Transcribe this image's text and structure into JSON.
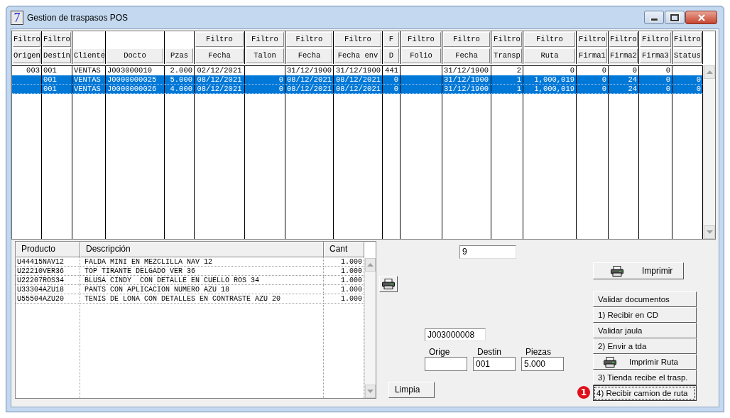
{
  "window": {
    "title": "Gestion de traspasos POS",
    "app_icon": "7"
  },
  "transfers": {
    "columns": [
      {
        "label": "Origen",
        "filter": "Filtro"
      },
      {
        "label": "Destin",
        "filter": "Filtro"
      },
      {
        "label": "Cliente"
      },
      {
        "label": "Docto"
      },
      {
        "label": "Pzas"
      },
      {
        "label": "Fecha",
        "filter": "Filtro"
      },
      {
        "label": "Talon",
        "filter": "Filtro"
      },
      {
        "label": "Fecha",
        "filter": "Filtro"
      },
      {
        "label": "Fecha env",
        "filter": "Filtro"
      },
      {
        "label": "D",
        "filter": "F"
      },
      {
        "label": "Folio",
        "filter": "Filtro"
      },
      {
        "label": "Fecha",
        "filter": "Filtro"
      },
      {
        "label": "Transp",
        "filter": "Filtro"
      },
      {
        "label": "Ruta",
        "filter": "Filtro"
      },
      {
        "label": "Firma1",
        "filter": "Filtro"
      },
      {
        "label": "Firma2",
        "filter": "Filtro"
      },
      {
        "label": "Firma3",
        "filter": "Filtro"
      },
      {
        "label": "Status",
        "filter": "Filtro"
      }
    ],
    "rows": [
      {
        "selected": false,
        "cells": [
          "003",
          "001",
          "VENTAS",
          "J003000010",
          "2.000",
          "02/12/2021",
          null,
          "31/12/1900",
          "31/12/1900",
          "441",
          null,
          "31/12/1900",
          "2",
          "0",
          "0",
          "0",
          "0",
          null
        ]
      },
      {
        "selected": true,
        "cells": [
          null,
          "001",
          "VENTAS",
          "J0000000025",
          "5.000",
          "08/12/2021",
          "0",
          "08/12/2021",
          "08/12/2021",
          "0",
          null,
          "31/12/1900",
          "1",
          "1,000,019",
          "0",
          "24",
          "0",
          "0"
        ]
      },
      {
        "selected": true,
        "cells": [
          null,
          "001",
          "VENTAS",
          "J0000000026",
          "4.000",
          "08/12/2021",
          "0",
          "08/12/2021",
          "08/12/2021",
          "0",
          null,
          "31/12/1900",
          "1",
          "1,000,019",
          "0",
          "24",
          "0",
          "0"
        ]
      }
    ]
  },
  "products": {
    "columns": [
      "Producto",
      "Descripción",
      "Cant"
    ],
    "rows": [
      [
        "U44415NAV12",
        "FALDA MINI EN MEZCLILLA NAV 12",
        "1.000"
      ],
      [
        "U22210VER36",
        "TOP TIRANTE DELGADO VER 36",
        "1.000"
      ],
      [
        "U22207ROS34",
        "BLUSA CINDY  CON DETALLE EN CUELLO ROS 34",
        "1.000"
      ],
      [
        "U33304AZU18",
        "PANTS CON APLICACION NUMERO AZU 18",
        "1.000"
      ],
      [
        "U55504AZU20",
        "TENIS DE LONA CON DETALLES EN CONTRASTE AZU 20",
        "1.000"
      ]
    ]
  },
  "count_field": {
    "value": "9"
  },
  "document_field": {
    "value": "J003000008"
  },
  "summary_fields": [
    {
      "label": "Orige"
    },
    {
      "label": "Destin",
      "value": "001"
    },
    {
      "label": "Piezas",
      "value": "5.000"
    }
  ],
  "clear_button": {
    "label": "Limpia"
  },
  "print_button": {
    "label": "Imprimir"
  },
  "actions": [
    {
      "label": "Validar documentos",
      "kind": "plain",
      "focused": false
    },
    {
      "label": "1) Recibir en CD",
      "kind": "plain",
      "focused": false
    },
    {
      "label": "Validar jaula",
      "kind": "plain",
      "focused": false
    },
    {
      "label": "2) Envir a tda",
      "kind": "plain",
      "focused": false
    },
    {
      "label": "Imprimir Ruta",
      "kind": "print",
      "focused": false
    },
    {
      "label": "3) Tienda recibe el trasp.",
      "kind": "plain",
      "focused": false
    },
    {
      "label": "4) Recibir camion de ruta",
      "kind": "plain",
      "focused": true,
      "badge": "1"
    }
  ]
}
